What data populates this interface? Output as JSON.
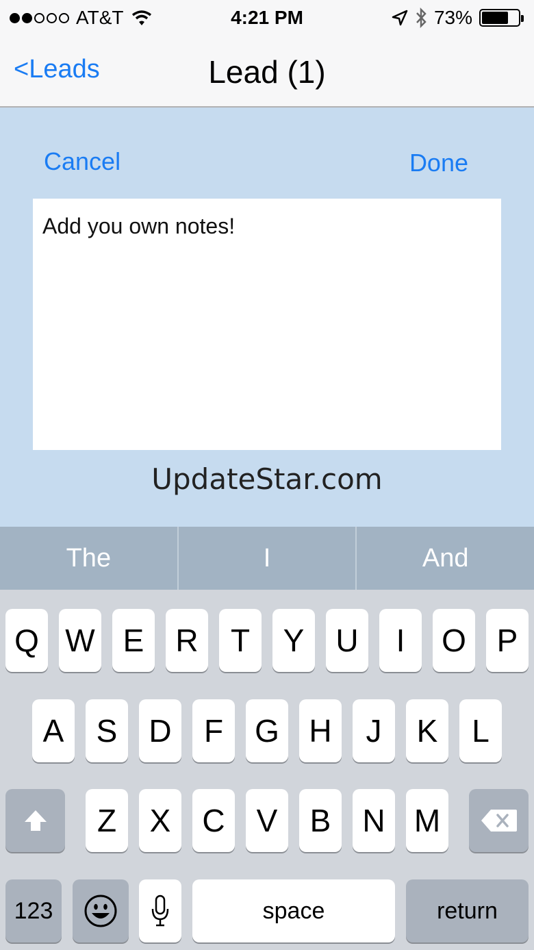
{
  "status_bar": {
    "carrier": "AT&T",
    "time": "4:21 PM",
    "battery": "73%",
    "battery_level": 0.73
  },
  "nav": {
    "back_label": "<Leads",
    "title": "Lead (1)"
  },
  "editor": {
    "cancel_label": "Cancel",
    "done_label": "Done",
    "notes_text": "Add you own notes!"
  },
  "watermark": "UpdateStar.com",
  "suggestions": [
    "The",
    "I",
    "And"
  ],
  "keyboard": {
    "row1": [
      "Q",
      "W",
      "E",
      "R",
      "T",
      "Y",
      "U",
      "I",
      "O",
      "P"
    ],
    "row2": [
      "A",
      "S",
      "D",
      "F",
      "G",
      "H",
      "J",
      "K",
      "L"
    ],
    "row3": [
      "Z",
      "X",
      "C",
      "V",
      "B",
      "N",
      "M"
    ],
    "numbers_label": "123",
    "space_label": "space",
    "return_label": "return",
    "icons": {
      "shift": "shift-icon",
      "delete": "delete-icon",
      "emoji": "emoji-icon",
      "mic": "microphone-icon"
    }
  }
}
